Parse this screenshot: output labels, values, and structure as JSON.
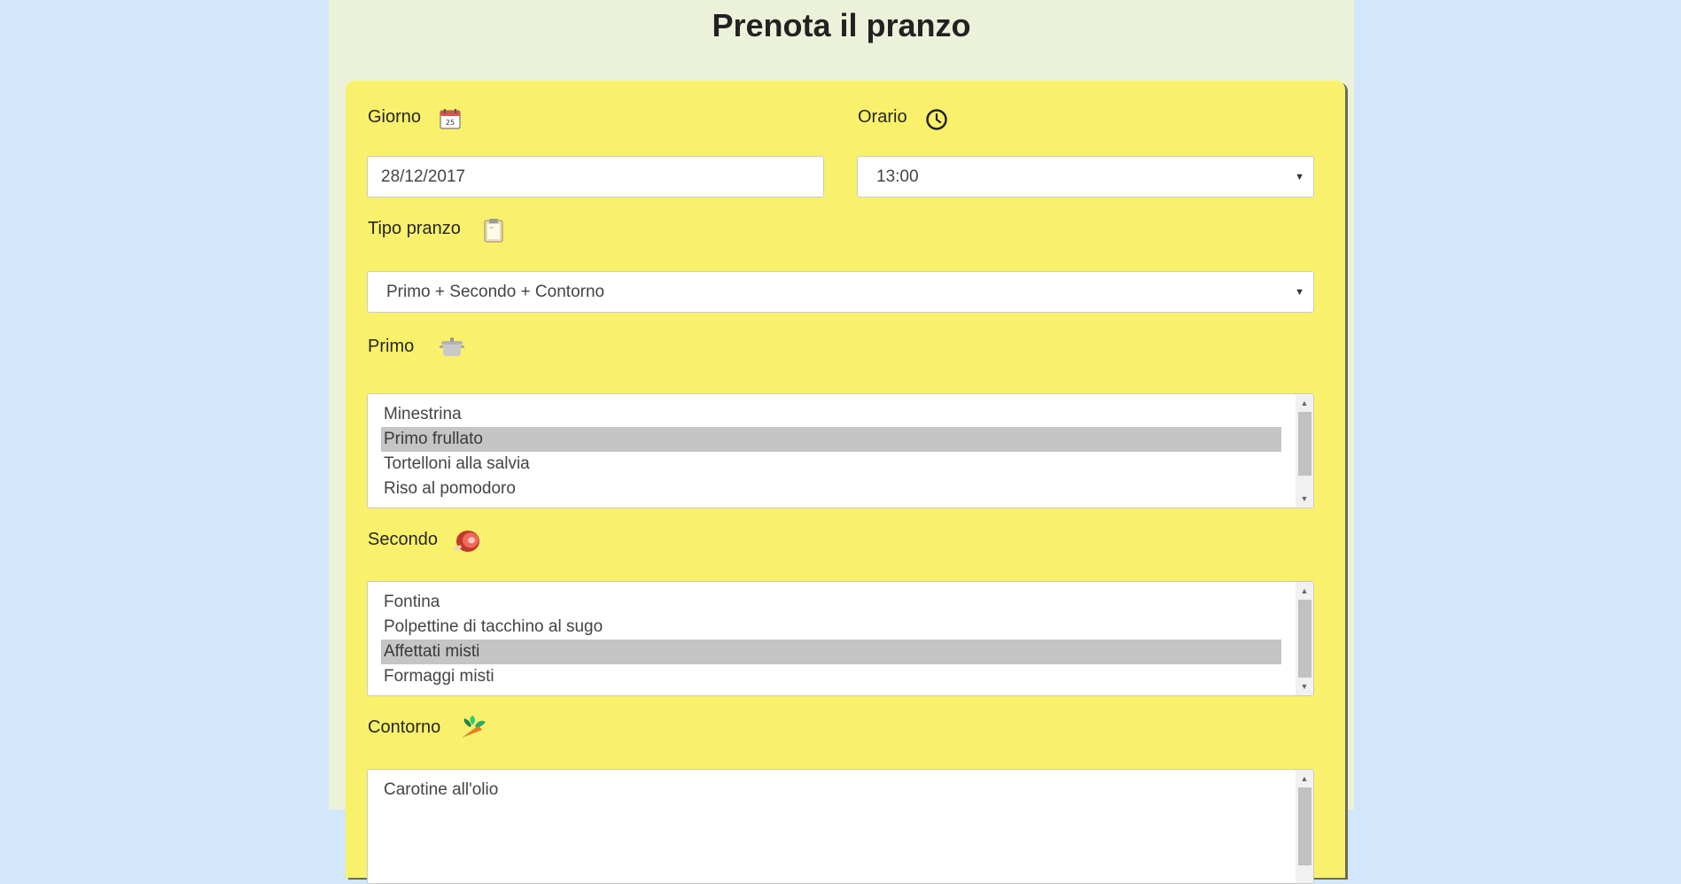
{
  "page": {
    "title": "Prenota il pranzo"
  },
  "labels": {
    "giorno": "Giorno",
    "orario": "Orario",
    "tipo_pranzo": "Tipo pranzo",
    "primo": "Primo",
    "secondo": "Secondo",
    "contorno": "Contorno"
  },
  "giorno": {
    "value": "28/12/2017"
  },
  "orario": {
    "value": "13:00"
  },
  "tipo_pranzo": {
    "value": "Primo + Secondo + Contorno"
  },
  "primo": {
    "options": [
      "Minestrina",
      "Primo frullato",
      "Tortelloni alla salvia",
      "Riso al pomodoro",
      ""
    ],
    "selected": "Primo frullato"
  },
  "secondo": {
    "options": [
      "Fontina",
      "Polpettine di tacchino al sugo",
      "Affettati misti",
      "Formaggi misti"
    ],
    "selected": "Affettati misti"
  },
  "contorno": {
    "options": [
      "Carotine all'olio",
      ""
    ]
  },
  "icons": {
    "giorno": "calendar-icon",
    "orario": "clock-icon",
    "tipo_pranzo": "clipboard-icon",
    "primo": "pot-icon",
    "secondo": "ham-icon",
    "contorno": "vegetables-icon"
  },
  "colors": {
    "background": "#d2e6fc",
    "page_column": "#ecf2da",
    "card": "#f9f16b",
    "selected_option": "#c5c5c5"
  }
}
